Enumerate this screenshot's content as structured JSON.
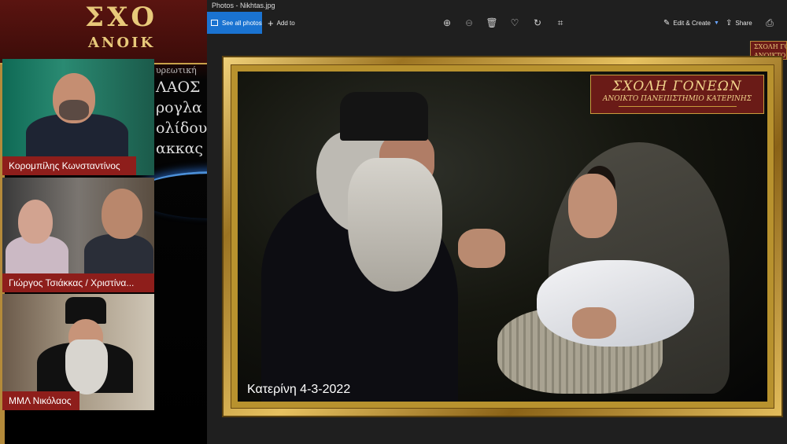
{
  "slide": {
    "banner_line1": "ΣΧΟ",
    "banner_line2": "ΑΝΟΙΚ",
    "lines": [
      "υρεωτική",
      "ΛΑΟΣ",
      "ρογλα",
      "ολίδου",
      "ακκας"
    ]
  },
  "participants": [
    {
      "name": "Κορομπίλης Κωνσταντίνος"
    },
    {
      "name": "Γιώργος Τσιάκκας / Χριστίνα..."
    },
    {
      "name": "ΜΜΛ Νικόλαος"
    }
  ],
  "app": {
    "title": "Photos - Nikhtas.jpg",
    "toolbar": {
      "see_all_photos": "See all photos",
      "add_to": "Add to",
      "edit_create": "Edit & Create",
      "share": "Share"
    },
    "thumb_badge": "ΣΧΟΛΗ ΓΟ\nΑΝΟΙΚΤΟ ΠΑΝ"
  },
  "photo": {
    "logo_title": "ΣΧΟΛΗ ΓΟΝΕΩΝ",
    "logo_subtitle": "ΑΝΟΙΚΤΟ ΠΑΝΕΠΙΣΤΗΜΙΟ ΚΑΤΕΡΙΝΗΣ",
    "caption": "Κατερίνη 4-3-2022"
  },
  "colors": {
    "nameplate": "#8e1e1b",
    "accent_blue": "#1a73d1",
    "gold": "#c9a24a"
  }
}
